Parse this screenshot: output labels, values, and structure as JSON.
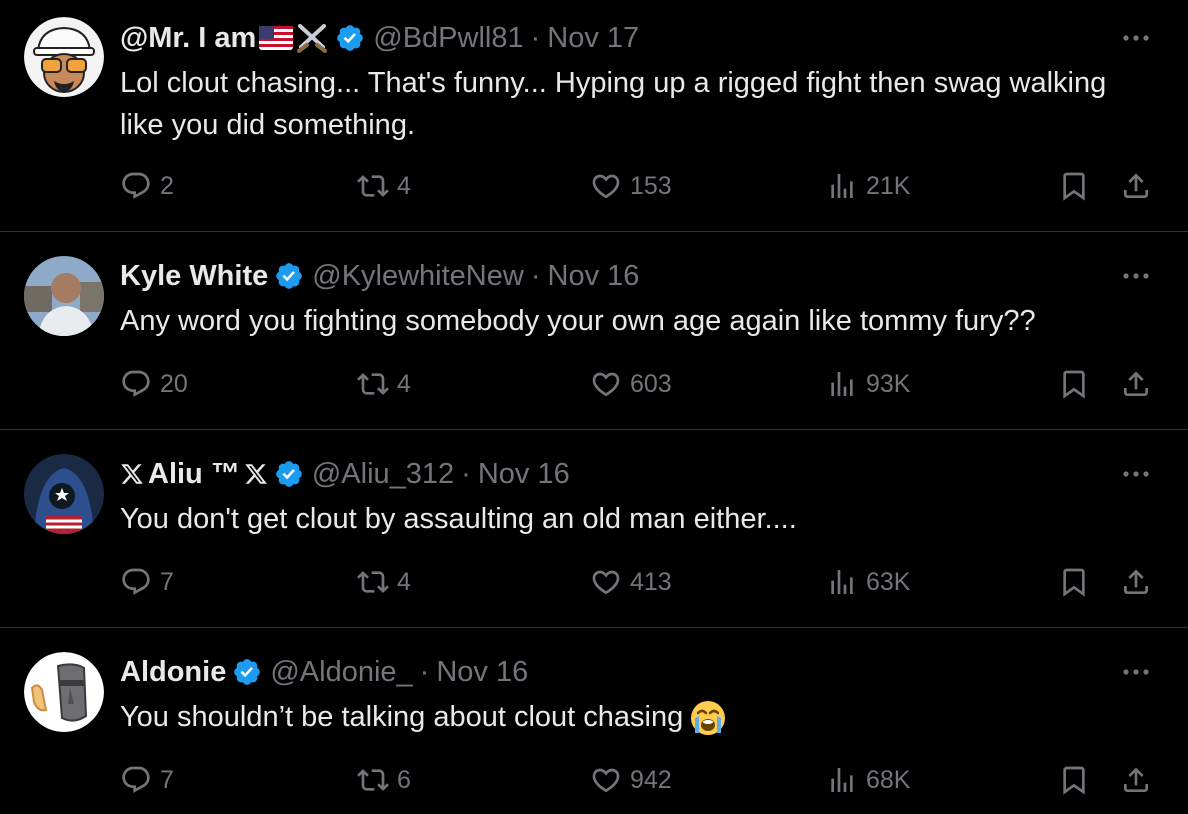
{
  "tweets": [
    {
      "display_name": "@Mr. I am",
      "handle": "@BdPwll81",
      "date": "Nov 17",
      "text": "Lol clout chasing... That's funny... Hyping up a rigged fight then swag walking like you did something.",
      "replies": "2",
      "reposts": "4",
      "likes": "153",
      "views": "21K"
    },
    {
      "display_name": "Kyle White",
      "handle": "@KylewhiteNew",
      "date": "Nov 16",
      "text": "Any word you fighting somebody your own age again like tommy fury??",
      "replies": "20",
      "reposts": "4",
      "likes": "603",
      "views": "93K"
    },
    {
      "display_name": "Aliu ™",
      "handle": "@Aliu_312",
      "date": "Nov 16",
      "text": "You don't get clout by assaulting an old man either....",
      "replies": "7",
      "reposts": "4",
      "likes": "413",
      "views": "63K"
    },
    {
      "display_name": "Aldonie",
      "handle": "@Aldonie_",
      "date": "Nov 16",
      "text": "You shouldn’t be talking about clout chasing",
      "replies": "7",
      "reposts": "6",
      "likes": "942",
      "views": "68K"
    }
  ],
  "separator": "·",
  "colors": {
    "background": "#000000",
    "text": "#e7e9ea",
    "muted": "#71767b",
    "verified": "#1d9bf0",
    "divider": "#2f3336"
  },
  "icons": [
    "reply-icon",
    "repost-icon",
    "like-icon",
    "views-icon",
    "bookmark-icon",
    "share-icon",
    "more-icon",
    "verified-badge-icon",
    "x-logo-icon",
    "us-flag-emoji",
    "crossed-swords-emoji",
    "crying-face-emoji"
  ]
}
